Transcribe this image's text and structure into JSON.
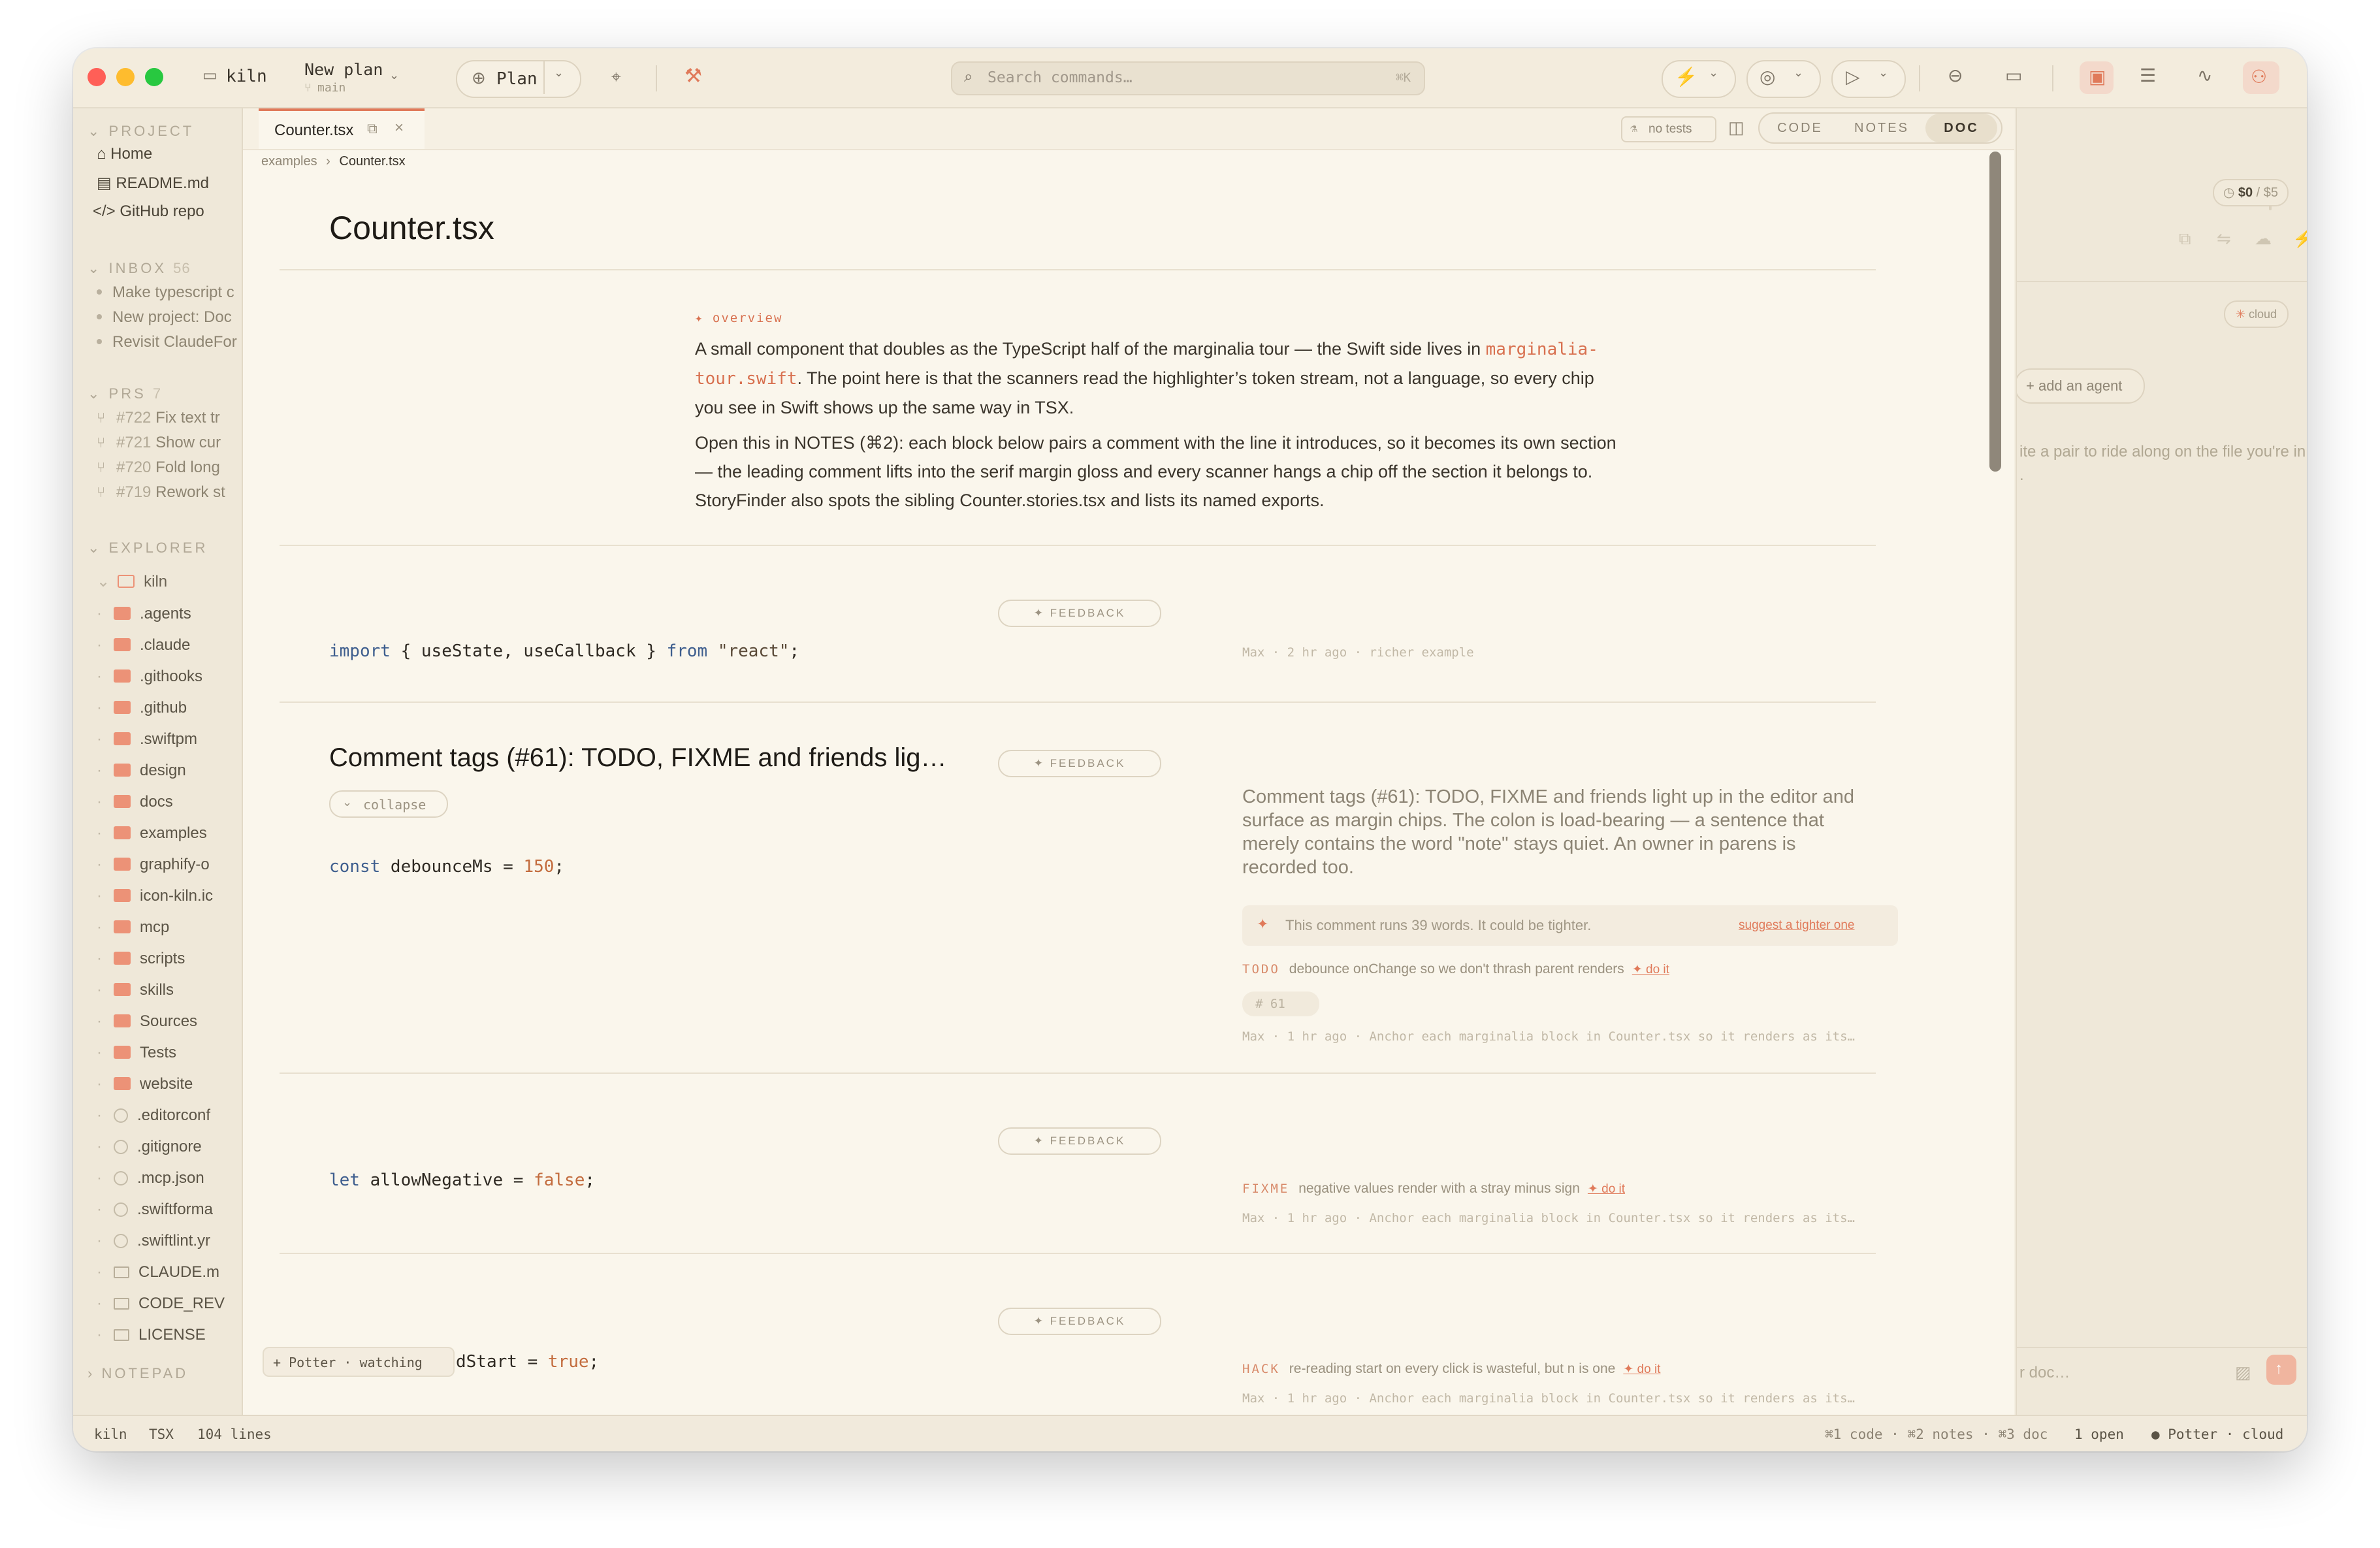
{
  "titlebar": {
    "project": "kiln",
    "plan_title": "New plan",
    "branch": "main",
    "mode": "Plan",
    "search_placeholder": "Search commands…",
    "search_shortcut": "⌘K"
  },
  "sidebar": {
    "project_header": "PROJECT",
    "project_items": [
      "Home",
      "README.md",
      "GitHub repo"
    ],
    "inbox_header": "INBOX",
    "inbox_count": "56",
    "inbox_items": [
      "Make typescript c",
      "New project: Doc",
      "Revisit ClaudeFor"
    ],
    "prs_header": "PRS",
    "prs_count": "7",
    "prs": [
      {
        "num": "#722",
        "title": "Fix text tr"
      },
      {
        "num": "#721",
        "title": "Show cur"
      },
      {
        "num": "#720",
        "title": "Fold long"
      },
      {
        "num": "#719",
        "title": "Rework st"
      }
    ],
    "explorer_header": "EXPLORER",
    "explorer_root": "kiln",
    "folders": [
      ".agents",
      ".claude",
      ".githooks",
      ".github",
      ".swiftpm",
      "design",
      "docs",
      "examples",
      "graphify-o",
      "icon-kiln.ic",
      "mcp",
      "scripts",
      "skills",
      "Sources",
      "Tests",
      "website"
    ],
    "config_files": [
      ".editorconf",
      ".gitignore",
      ".mcp.json",
      ".swiftforma",
      ".swiftlint.yr"
    ],
    "doc_files": [
      "CLAUDE.m",
      "CODE_REV",
      "LICENSE"
    ],
    "notepad_header": "NOTEPAD"
  },
  "editor": {
    "tab_label": "Counter.tsx",
    "no_tests": "no tests",
    "view_modes": [
      "CODE",
      "NOTES",
      "DOC"
    ],
    "active_mode": "DOC",
    "breadcrumb_folder": "examples",
    "breadcrumb_file": "Counter.tsx",
    "doc_title": "Counter.tsx",
    "overview_label": "✦ overview",
    "overview_p1_a": "A small component that doubles as the TypeScript half of the marginalia tour — the Swift side lives in",
    "overview_p1_link": "marginalia-tour.swift",
    "overview_p1_b": ". The point here is that the scanners read the highlighter’s token stream, not a language, so every chip you see in Swift shows up the same way in TSX.",
    "overview_p2": "Open this in NOTES (⌘2): each block below pairs a comment with the line it introduces, so it becomes its own section — the leading comment lifts into the serif margin gloss and every scanner hangs a chip off the section it belongs to. StoryFinder also spots the sibling Counter.stories.tsx and lists its named exports.",
    "feedback_label": "✦ FEEDBACK",
    "block1_meta": "Max · 2 hr ago · richer example",
    "section2_title": "Comment tags (#61): TODO, FIXME and friends lig…",
    "collapse_label": "collapse",
    "section2_gloss": "Comment tags (#61): TODO, FIXME and friends light up in the editor and surface as margin chips. The colon is load-bearing — a sentence that merely contains the word \"note\" stays quiet. An owner in parens is recorded too.",
    "tighter_note": "This comment runs 39 words. It could be tighter.",
    "tighter_link": "suggest a tighter one",
    "todo_tag": "TODO",
    "todo_text": "debounce onChange so we don't thrash parent renders",
    "do_it": "✦ do it",
    "issue_ref": "# 61",
    "anchor_meta": "Max · 1 hr ago · Anchor each marginalia block in Counter.tsx so it renders as its…",
    "fixme_tag": "FIXME",
    "fixme_text": "negative values render with a stray minus sign",
    "hack_tag": "HACK",
    "hack_text": "re-reading start on every click is wasteful, but n is one",
    "anchor_meta_cut": "Max · 1 hr ago · Anchor each marginalia block in Counter.tsx so it renders as its…",
    "presence_badge": "+ Potter · watching",
    "code_last_tail": "dStart = true;"
  },
  "rpanel": {
    "cost": "$0",
    "budget": "/ $5",
    "cloud": "cloud",
    "add_agent": "+ add an agent",
    "hint": "ite a pair to ride along on the file you're in,",
    "hint2": ".",
    "doc_input_placeholder": "r doc…"
  },
  "statusbar": {
    "project": "kiln",
    "lang": "TSX",
    "lines": "104 lines",
    "shortcuts": "⌘1 code · ⌘2 notes · ⌘3 doc",
    "open": "1 open",
    "presence": "● Potter · cloud"
  },
  "colors": {
    "accent": "#e07a5a",
    "background": "#f5efe2",
    "folder": "#ec9277",
    "keyword": "#3e5e8e",
    "number": "#c36c3e"
  }
}
